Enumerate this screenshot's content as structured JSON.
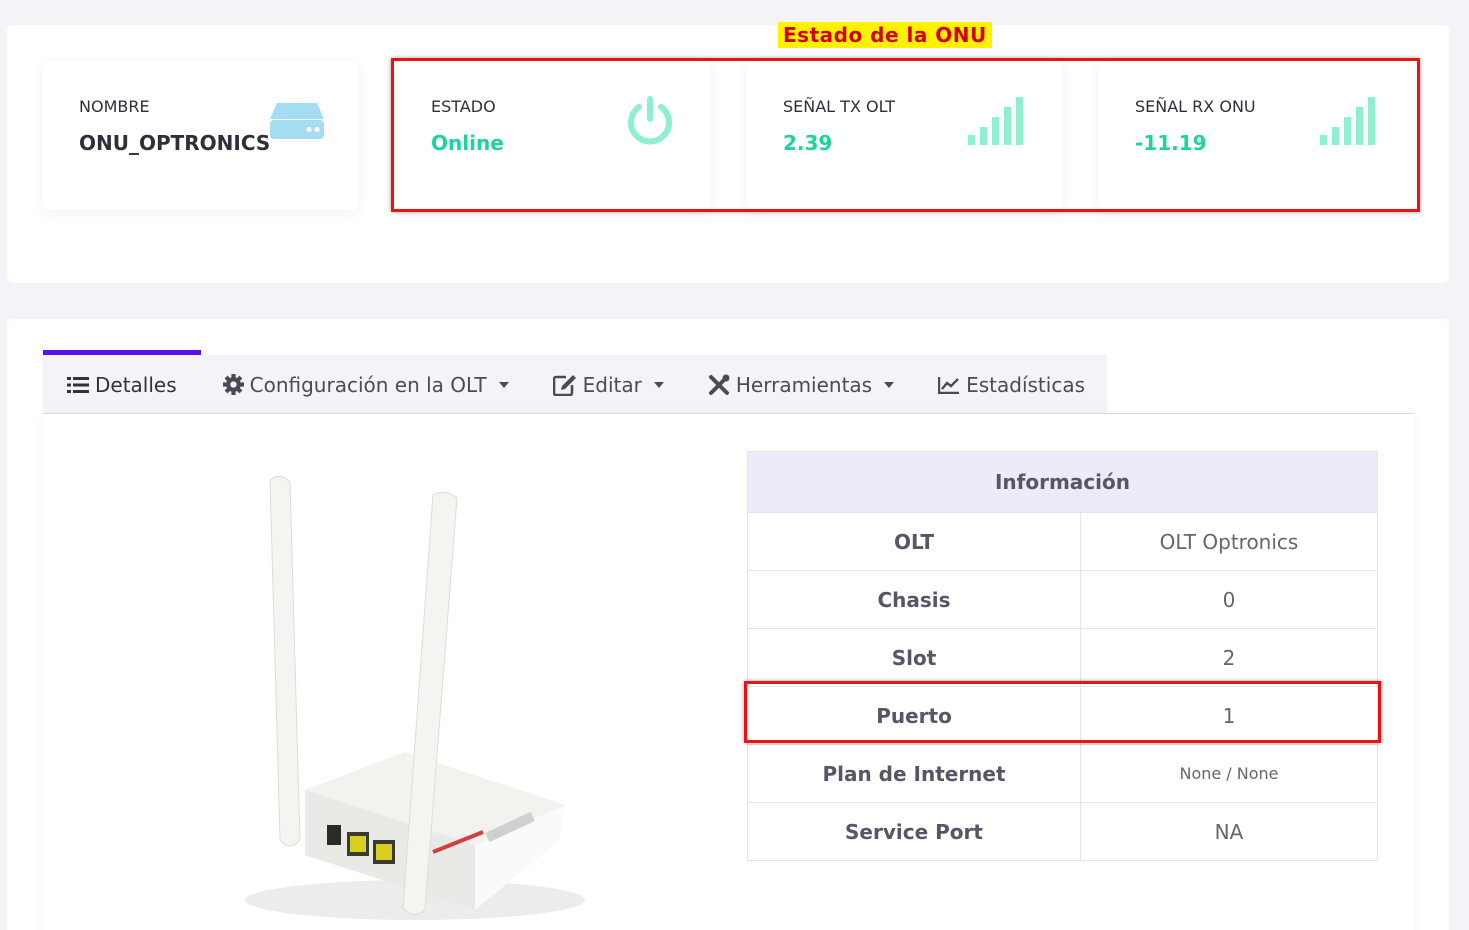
{
  "annotation": {
    "title": "Estado de la ONU"
  },
  "cards": {
    "nombre": {
      "label": "NOMBRE",
      "value": "ONU_OPTRONICS",
      "icon": "server-icon"
    },
    "estado": {
      "label": "ESTADO",
      "value": "Online",
      "icon": "power-icon"
    },
    "tx": {
      "label": "SEÑAL TX OLT",
      "value": "2.39",
      "icon": "signal-icon"
    },
    "rx": {
      "label": "SEÑAL RX ONU",
      "value": "-11.19",
      "icon": "signal-icon"
    }
  },
  "tabs": [
    {
      "label": "Detalles",
      "icon": "list-icon",
      "active": true
    },
    {
      "label": "Configuración en la OLT",
      "icon": "gear-icon",
      "dropdown": true
    },
    {
      "label": "Editar",
      "icon": "edit-icon",
      "dropdown": true
    },
    {
      "label": "Herramientas",
      "icon": "tools-icon",
      "dropdown": true
    },
    {
      "label": "Estadísticas",
      "icon": "chart-line-icon"
    }
  ],
  "info": {
    "header": "Información",
    "rows": [
      {
        "key": "OLT",
        "value": "OLT Optronics"
      },
      {
        "key": "Chasis",
        "value": "0"
      },
      {
        "key": "Slot",
        "value": "2"
      },
      {
        "key": "Puerto",
        "value": "1"
      },
      {
        "key": "Plan de Internet",
        "value": "None / None"
      },
      {
        "key": "Service Port",
        "value": "NA"
      }
    ]
  },
  "colors": {
    "accent": "#5b0ef0",
    "online": "#1ed49a",
    "signal": "#8ff0cf",
    "highlight": "#e11111"
  }
}
